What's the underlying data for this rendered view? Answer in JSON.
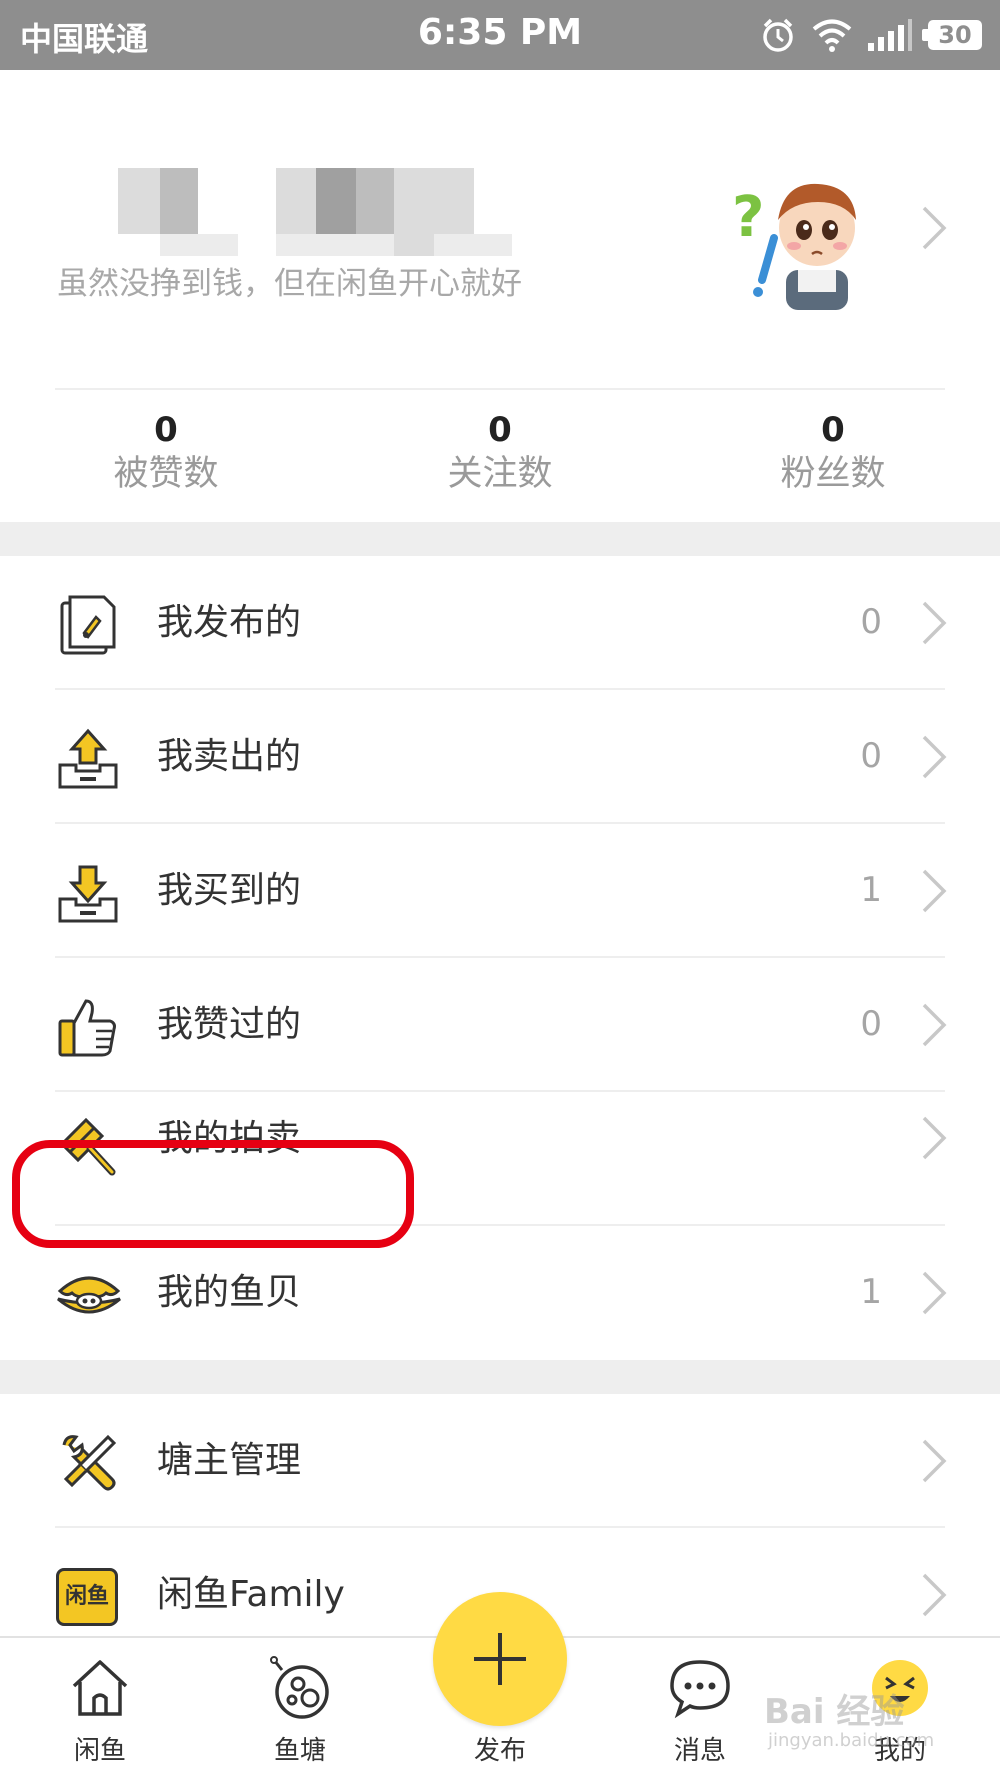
{
  "status_bar": {
    "carrier": "中国联通",
    "time": "6:35 PM",
    "battery": "30",
    "icons": [
      "alarm-icon",
      "wifi-icon",
      "signal-icon",
      "battery-icon"
    ]
  },
  "profile": {
    "motto": "虽然没挣到钱，但在闲鱼开心就好",
    "avatar": "cartoon-avatar",
    "stats": [
      {
        "value": "0",
        "label": "被赞数"
      },
      {
        "value": "0",
        "label": "关注数"
      },
      {
        "value": "0",
        "label": "粉丝数"
      }
    ]
  },
  "menu_group1": [
    {
      "label": "我发布的",
      "count": "0",
      "icon": "published-icon"
    },
    {
      "label": "我卖出的",
      "count": "0",
      "icon": "sold-icon"
    },
    {
      "label": "我买到的",
      "count": "1",
      "icon": "bought-icon"
    },
    {
      "label": "我赞过的",
      "count": "0",
      "icon": "thumbs-up-icon"
    },
    {
      "label": "我的拍卖",
      "count": "",
      "icon": "auction-hammer-icon"
    },
    {
      "label": "我的鱼贝",
      "count": "1",
      "icon": "shell-icon"
    }
  ],
  "menu_group2": [
    {
      "label": "塘主管理",
      "icon": "tools-icon"
    },
    {
      "label": "闲鱼Family",
      "icon": "family-badge-icon",
      "badge_text": "闲鱼"
    }
  ],
  "tabbar": {
    "tabs": [
      {
        "label": "闲鱼",
        "icon": "home-icon"
      },
      {
        "label": "鱼塘",
        "icon": "pond-icon"
      },
      {
        "label": "发布",
        "icon": "plus-icon"
      },
      {
        "label": "消息",
        "icon": "message-icon"
      },
      {
        "label": "我的",
        "icon": "face-icon"
      }
    ]
  },
  "watermark": {
    "text": "Bai 经验",
    "sub": "jingyan.baidu.com"
  },
  "colors": {
    "accent": "#ffda44",
    "annotation": "#e60012",
    "statusbar": "#8e8e8e"
  }
}
